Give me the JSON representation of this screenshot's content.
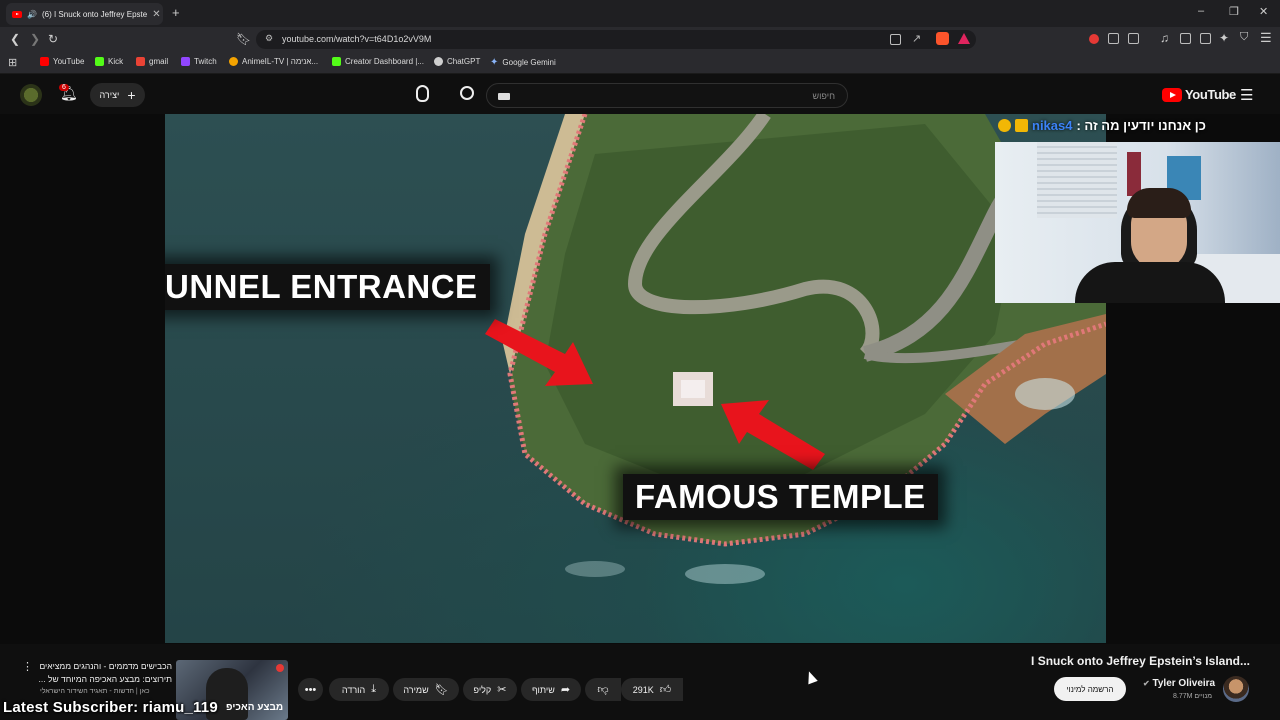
{
  "browser": {
    "tab_title": "(6) I Snuck onto Jeffrey Epste",
    "new_tab_symbol": "+",
    "url": "youtube.com/watch?v=t64D1o2vV9M",
    "bookmarks": [
      {
        "label": "YouTube",
        "icon_color": "#ff0000"
      },
      {
        "label": "Kick",
        "icon_color": "#53fc18"
      },
      {
        "label": "gmail",
        "icon_color": "#ea4335"
      },
      {
        "label": "Twitch",
        "icon_color": "#9146ff"
      },
      {
        "label": "AnimeIL-TV | אנימה...",
        "icon_color": "#f4a300"
      },
      {
        "label": "Creator Dashboard |...",
        "icon_color": "#53fc18"
      },
      {
        "label": "ChatGPT",
        "icon_color": "#cfcfcf"
      },
      {
        "label": "Google Gemini",
        "icon_color": "#8ab4f8"
      }
    ]
  },
  "youtube": {
    "logo_text": "YouTube",
    "search_placeholder": "חיפוש",
    "create_label": "יצירה",
    "notification_count": "6"
  },
  "video": {
    "callout_tunnel": "UNNEL ENTRANCE",
    "callout_temple": "FAMOUS TEMPLE",
    "title": "I Snuck onto Jeffrey Epstein’s Island...",
    "channel": "Tyler Oliveira",
    "subscribers": "8.77M מנויים",
    "subscribe_label": "הרשמה למינוי",
    "likes": "291K",
    "share_label": "שיתוף",
    "clip_label": "קליפ",
    "save_label": "שמירה",
    "download_label": "הורדה"
  },
  "stream_overlay": {
    "chat_user": "nikas4",
    "chat_message": "כן אנחנו יודעין מה זה :",
    "latest_subscriber": "Latest Subscriber: riamu_119"
  },
  "recommendation": {
    "title": "הכבישים מדממים - והנהגים ממציאים תירוצים: מבצע האכיפה המיוחד של ...",
    "channel": "כאן | חדשות - תאגיד השידור הישראלי",
    "thumb_text": "מבצע האכיפ"
  },
  "colors": {
    "brand_red": "#ff0000",
    "chat_user_blue": "#3b82f6",
    "page_bg": "#0f0f0f"
  }
}
